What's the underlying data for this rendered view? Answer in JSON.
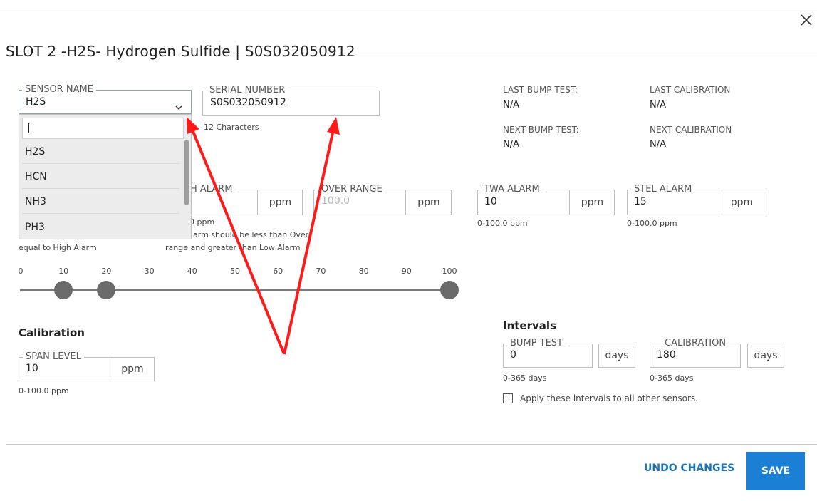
{
  "header": {
    "title": "SLOT 2 -H2S- Hydrogen Sulfide | S0S032050912",
    "close_icon": "close-icon"
  },
  "sensor_name": {
    "label": "SENSOR NAME",
    "value": "H2S",
    "dropdown_options": [
      "H2S",
      "HCN",
      "NH3",
      "PH3"
    ]
  },
  "serial_number": {
    "label": "SERIAL NUMBER",
    "value": "S0S032050912",
    "hint": "12 Characters"
  },
  "last_bump_test": {
    "label": "LAST BUMP TEST:",
    "value": "N/A"
  },
  "last_calibration": {
    "label": "LAST CALIBRATION",
    "value": "N/A"
  },
  "next_bump_test": {
    "label": "NEXT BUMP TEST:",
    "value": "N/A"
  },
  "next_calibration": {
    "label": "NEXT CALIBRATION",
    "value": "N/A"
  },
  "alarms": {
    "low_alarm_hint_partial": "equal to High Alarm",
    "high_alarm": {
      "label_partial": "H ALARM",
      "unit": "ppm",
      "range_partial": "0 ppm",
      "hint_line1": "arm should be less than Over",
      "hint_line2": "range and greater than Low Alarm"
    },
    "over_range": {
      "label": "OVER RANGE",
      "value": "100.0",
      "unit": "ppm"
    },
    "twa_alarm": {
      "label": "TWA ALARM",
      "value": "10",
      "unit": "ppm",
      "range": "0-100.0 ppm"
    },
    "stel_alarm": {
      "label": "STEL ALARM",
      "value": "15",
      "unit": "ppm",
      "range": "0-100.0 ppm"
    }
  },
  "slider": {
    "ticks": [
      "0",
      "10",
      "20",
      "30",
      "40",
      "50",
      "60",
      "70",
      "80",
      "90",
      "100"
    ],
    "min": 0,
    "max": 100,
    "knob_values": [
      10,
      20,
      100
    ]
  },
  "calibration": {
    "heading": "Calibration",
    "span_level": {
      "label": "SPAN LEVEL",
      "value": "10",
      "unit": "ppm",
      "range": "0-100.0 ppm"
    }
  },
  "intervals": {
    "heading": "Intervals",
    "bump_test": {
      "label": "BUMP TEST",
      "value": "0",
      "unit": "days",
      "range": "0-365 days"
    },
    "calibration": {
      "label": "CALIBRATION",
      "value": "180",
      "unit": "days",
      "range": "0-365 days"
    },
    "apply_all_label": "Apply these intervals to all other sensors.",
    "apply_all_checked": false
  },
  "footer": {
    "undo_label": "UNDO CHANGES",
    "save_label": "SAVE"
  },
  "colors": {
    "primary": "#1b7fd6",
    "link": "#1a73b8",
    "annotation_arrow": "#ff1a1a"
  }
}
